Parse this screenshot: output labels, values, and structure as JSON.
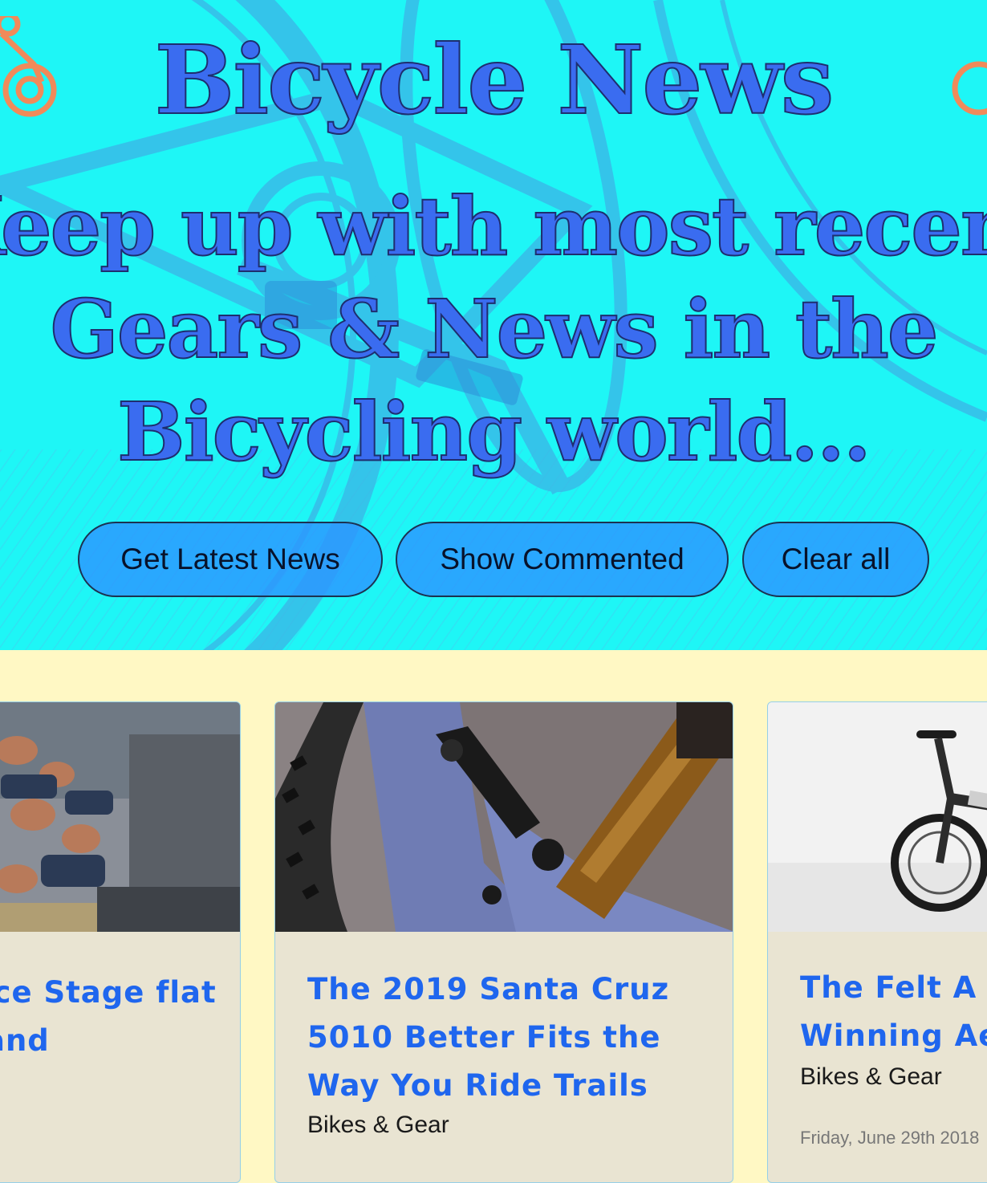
{
  "header": {
    "title": "Bicycle News",
    "tagline": "Keep up with most recent Gears & News in the Bicycling world..."
  },
  "buttons": {
    "latest": "Get Latest News",
    "commented": "Show Commented",
    "clear": "Clear all"
  },
  "articles": [
    {
      "title": "Tour de France Stage ... Flat and ...",
      "title_visible": "rance Stage flat and",
      "image": "race-crowd-photo"
    },
    {
      "title": "The 2019 Santa Cruz 5010 Better Fits the Way You Ride Trails",
      "category": "Bikes & Gear",
      "image": "mountain-bike-suspension-photo"
    },
    {
      "title": "The Felt AR ... Winning Ae...",
      "title_visible": "The Felt A\nWinning Ae",
      "category": "Bikes & Gear",
      "date": "Friday, June 29th 2018",
      "image": "road-bike-photo"
    }
  ],
  "colors": {
    "hero_bg": "#1ef6f6",
    "title": "#3a6cf0",
    "page_bg": "#fff8c4",
    "card_bg": "#e9e4d2",
    "card_title": "#1f66ee",
    "button_bg": "#2c96ff"
  }
}
